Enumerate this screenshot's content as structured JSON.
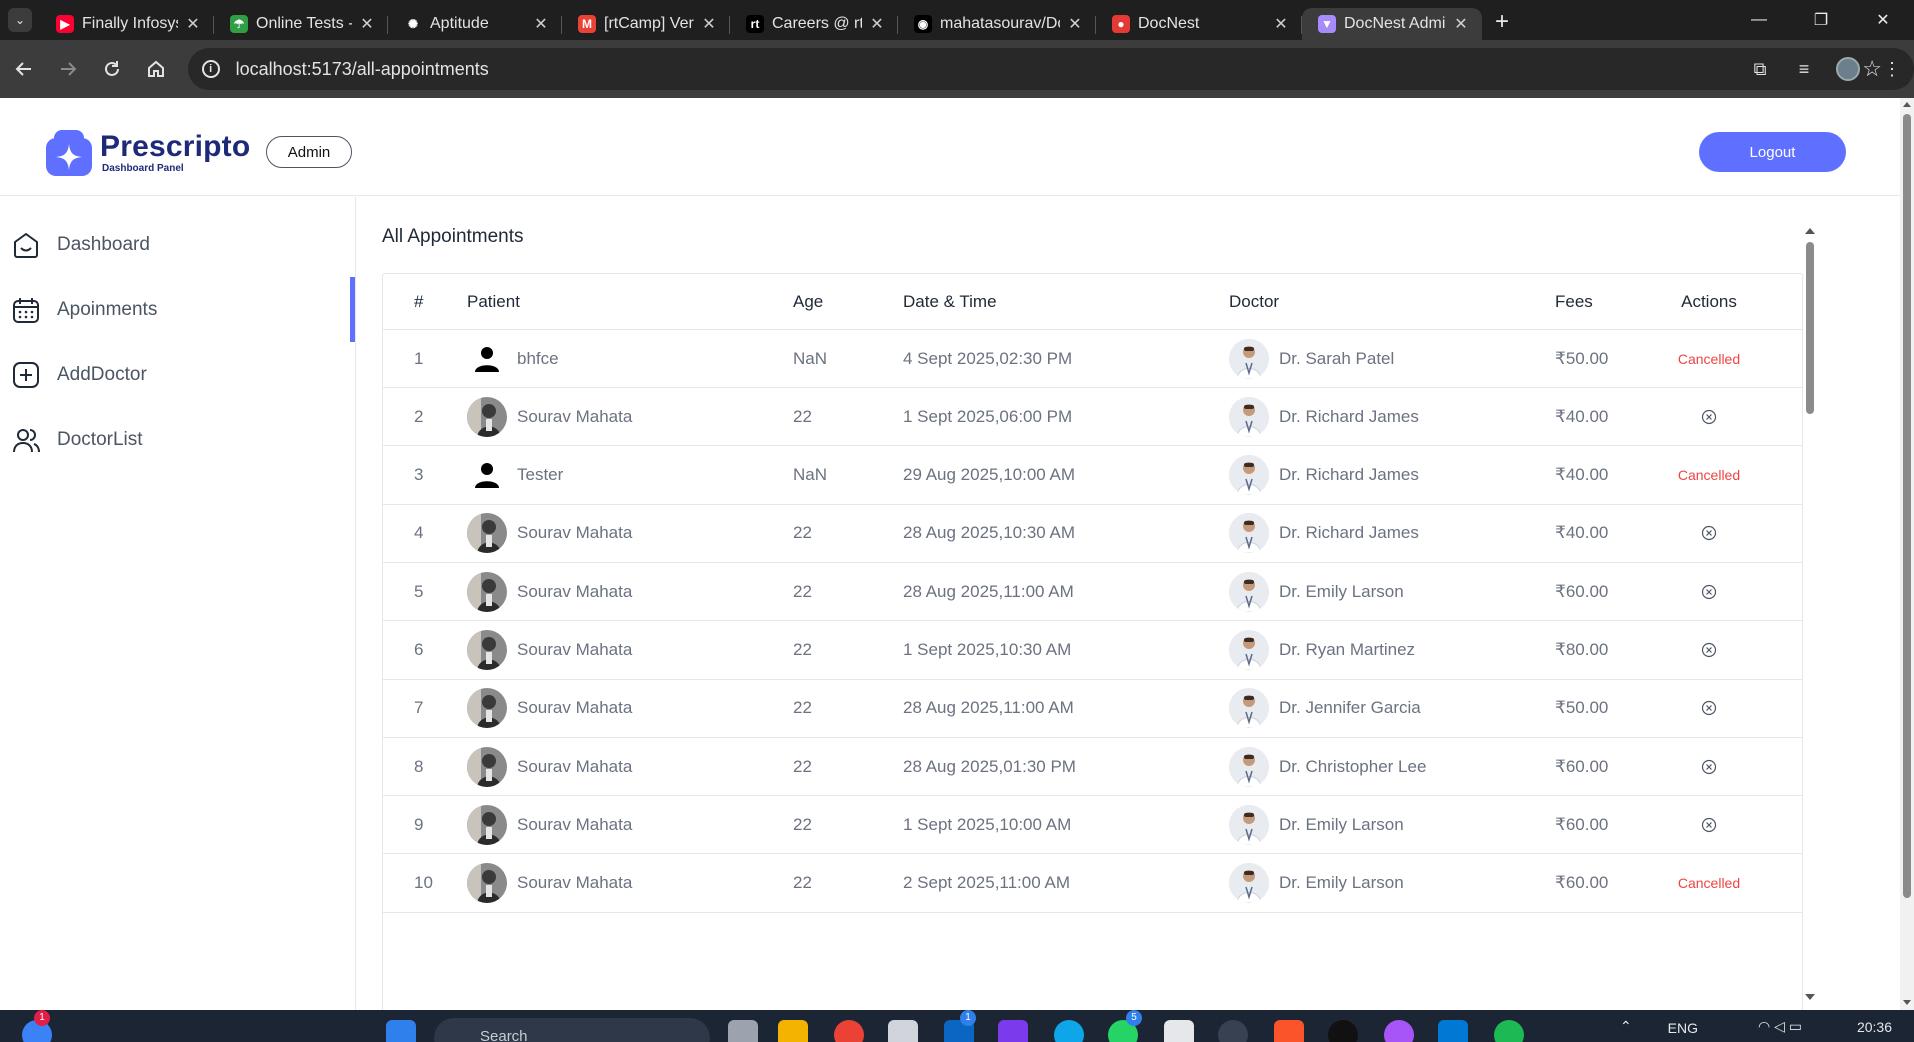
{
  "browser": {
    "tabs": [
      {
        "title": "Finally Infosys",
        "fav_color": "#ff0033",
        "fav_glyph": "▶"
      },
      {
        "title": "Online Tests - Online",
        "fav_color": "#2f9e44",
        "fav_glyph": "☂"
      },
      {
        "title": "Aptitude",
        "fav_color": "#1f1f1f",
        "fav_glyph": "✺"
      },
      {
        "title": "[rtCamp] Verification",
        "fav_color": "#ea4335",
        "fav_glyph": "M"
      },
      {
        "title": "Careers @ rtCamp",
        "fav_color": "#000000",
        "fav_glyph": "rt"
      },
      {
        "title": "mahatasourav/DocNest",
        "fav_color": "#000000",
        "fav_glyph": "◉"
      },
      {
        "title": "DocNest",
        "fav_color": "#e53935",
        "fav_glyph": "●"
      },
      {
        "title": "DocNest Admin",
        "fav_color": "#a78bfa",
        "fav_glyph": "▼"
      }
    ],
    "url": "localhost:5173/all-appointments"
  },
  "header": {
    "logo_name": "Prescripto",
    "logo_sub": "Dashboard Panel",
    "role_badge": "Admin",
    "logout_label": "Logout",
    "accent": "#5f6fff"
  },
  "sidebar": {
    "items": [
      {
        "label": "Dashboard",
        "icon": "home-icon"
      },
      {
        "label": "Apoinments",
        "icon": "calendar-icon"
      },
      {
        "label": "AddDoctor",
        "icon": "add-square-icon"
      },
      {
        "label": "DoctorList",
        "icon": "people-icon"
      }
    ],
    "active_index": 1
  },
  "main": {
    "title": "All Appointments",
    "columns": [
      "#",
      "Patient",
      "Age",
      "Date & Time",
      "Doctor",
      "Fees",
      "Actions"
    ],
    "rows": [
      {
        "num": "1",
        "patient": "bhfce",
        "patient_avatar": "placeholder",
        "age": "NaN",
        "datetime": "4 Sept 2025,02:30 PM",
        "doctor": "Dr. Sarah Patel",
        "fees": "₹50.00",
        "action": "Cancelled"
      },
      {
        "num": "2",
        "patient": "Sourav Mahata",
        "patient_avatar": "photo",
        "age": "22",
        "datetime": "1 Sept 2025,06:00 PM",
        "doctor": "Dr. Richard James",
        "fees": "₹40.00",
        "action": "cancel-icon"
      },
      {
        "num": "3",
        "patient": "Tester",
        "patient_avatar": "placeholder",
        "age": "NaN",
        "datetime": "29 Aug 2025,10:00 AM",
        "doctor": "Dr. Richard James",
        "fees": "₹40.00",
        "action": "Cancelled"
      },
      {
        "num": "4",
        "patient": "Sourav Mahata",
        "patient_avatar": "photo",
        "age": "22",
        "datetime": "28 Aug 2025,10:30 AM",
        "doctor": "Dr. Richard James",
        "fees": "₹40.00",
        "action": "cancel-icon"
      },
      {
        "num": "5",
        "patient": "Sourav Mahata",
        "patient_avatar": "photo",
        "age": "22",
        "datetime": "28 Aug 2025,11:00 AM",
        "doctor": "Dr. Emily Larson",
        "fees": "₹60.00",
        "action": "cancel-icon"
      },
      {
        "num": "6",
        "patient": "Sourav Mahata",
        "patient_avatar": "photo",
        "age": "22",
        "datetime": "1 Sept 2025,10:30 AM",
        "doctor": "Dr. Ryan Martinez",
        "fees": "₹80.00",
        "action": "cancel-icon"
      },
      {
        "num": "7",
        "patient": "Sourav Mahata",
        "patient_avatar": "photo",
        "age": "22",
        "datetime": "28 Aug 2025,11:00 AM",
        "doctor": "Dr. Jennifer Garcia",
        "fees": "₹50.00",
        "action": "cancel-icon"
      },
      {
        "num": "8",
        "patient": "Sourav Mahata",
        "patient_avatar": "photo",
        "age": "22",
        "datetime": "28 Aug 2025,01:30 PM",
        "doctor": "Dr. Christopher Lee",
        "fees": "₹60.00",
        "action": "cancel-icon"
      },
      {
        "num": "9",
        "patient": "Sourav Mahata",
        "patient_avatar": "photo",
        "age": "22",
        "datetime": "1 Sept 2025,10:00 AM",
        "doctor": "Dr. Emily Larson",
        "fees": "₹60.00",
        "action": "cancel-icon"
      },
      {
        "num": "10",
        "patient": "Sourav Mahata",
        "patient_avatar": "photo",
        "age": "22",
        "datetime": "2 Sept 2025,11:00 AM",
        "doctor": "Dr. Emily Larson",
        "fees": "₹60.00",
        "action": "Cancelled"
      }
    ],
    "cancelled_color": "#ef4444"
  },
  "taskbar": {
    "search_placeholder": "Search",
    "language": "ENG",
    "time": "20:36",
    "badges": {
      "weather": "1",
      "linkedin": "1",
      "whatsapp": "5"
    }
  }
}
